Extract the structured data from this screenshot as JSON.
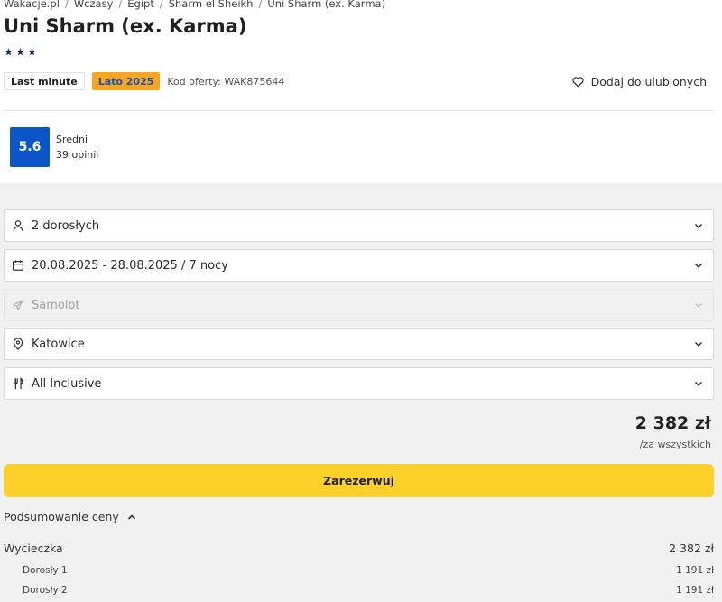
{
  "breadcrumb": [
    "Wakacje.pl",
    "Wczasy",
    "Egipt",
    "Sharm el Sheikh",
    "Uni Sharm (ex. Karma)"
  ],
  "hotel": {
    "title": "Uni Sharm (ex. Karma)",
    "stars": 3
  },
  "badges": {
    "last_minute": "Last minute",
    "season": "Lato 2025",
    "offer_code": "Kod oferty: WAK875644"
  },
  "favorite_label": "Dodaj do ulubionych",
  "rating": {
    "score": "5.6",
    "label": "Średni",
    "reviews": "39 opinii"
  },
  "fields": {
    "guests": "2 dorosłych",
    "dates": "20.08.2025 - 28.08.2025 / 7 nocy",
    "transport": "Samolot",
    "departure": "Katowice",
    "board": "All Inclusive"
  },
  "price": {
    "total": "2 382 zł",
    "per": "/za wszystkich"
  },
  "reserve_label": "Zarezerwuj",
  "summary": {
    "toggle_label": "Podsumowanie ceny",
    "trip_label": "Wycieczka",
    "trip_value": "2 382 zł",
    "items": [
      {
        "label": "Dorosły 1",
        "value": "1 191 zł"
      },
      {
        "label": "Dorosły 2",
        "value": "1 191 zł"
      }
    ]
  },
  "colors": {
    "rating_bg": "#0a56c8",
    "cta": "#fdd02a",
    "season_badge": "#f5a623"
  }
}
